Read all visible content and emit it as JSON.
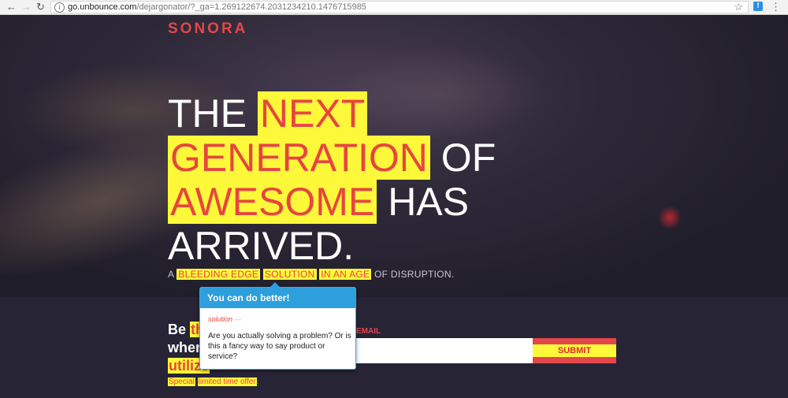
{
  "browser": {
    "back_glyph": "←",
    "forward_glyph": "→",
    "reload_glyph": "↻",
    "url_host": "go.unbounce.com",
    "url_path": "/dejargonator/?_ga=1.269122674.2031234210.1476715985",
    "bookmark_glyph": "☆",
    "extension_label": "!",
    "menu_glyph": "⋮"
  },
  "brand": {
    "logo": "SONORA",
    "accent": "#e2474a",
    "highlight": "#fdf83a",
    "highlight_text": "#e6463f"
  },
  "hero": {
    "headline": {
      "w1": "THE",
      "w2": "NEXT",
      "w3": "GENERATION",
      "w4": "OF",
      "w5": "AWESOME",
      "w6": "HAS",
      "w7": "ARRIVED."
    },
    "subline": {
      "s1": "A",
      "s2": "BLEEDING EDGE",
      "s3": "SOLUTION",
      "s4": "IN AN AGE",
      "s5": "OF DISRUPTION."
    }
  },
  "signup": {
    "p1": "Be",
    "p2": "th",
    "p3": "when",
    "p4": "utilize",
    "offer_1": "Special",
    "offer_2": "limited time offer",
    "offer_3": ".",
    "email_label": "EMAIL",
    "email_value": "",
    "submit_label": "SUBMIT"
  },
  "tooltip": {
    "title": "You can do better!",
    "word": "solution",
    "dash": "—",
    "body": "Are you actually solving a problem? Or is this a fancy way to say product or service?"
  }
}
